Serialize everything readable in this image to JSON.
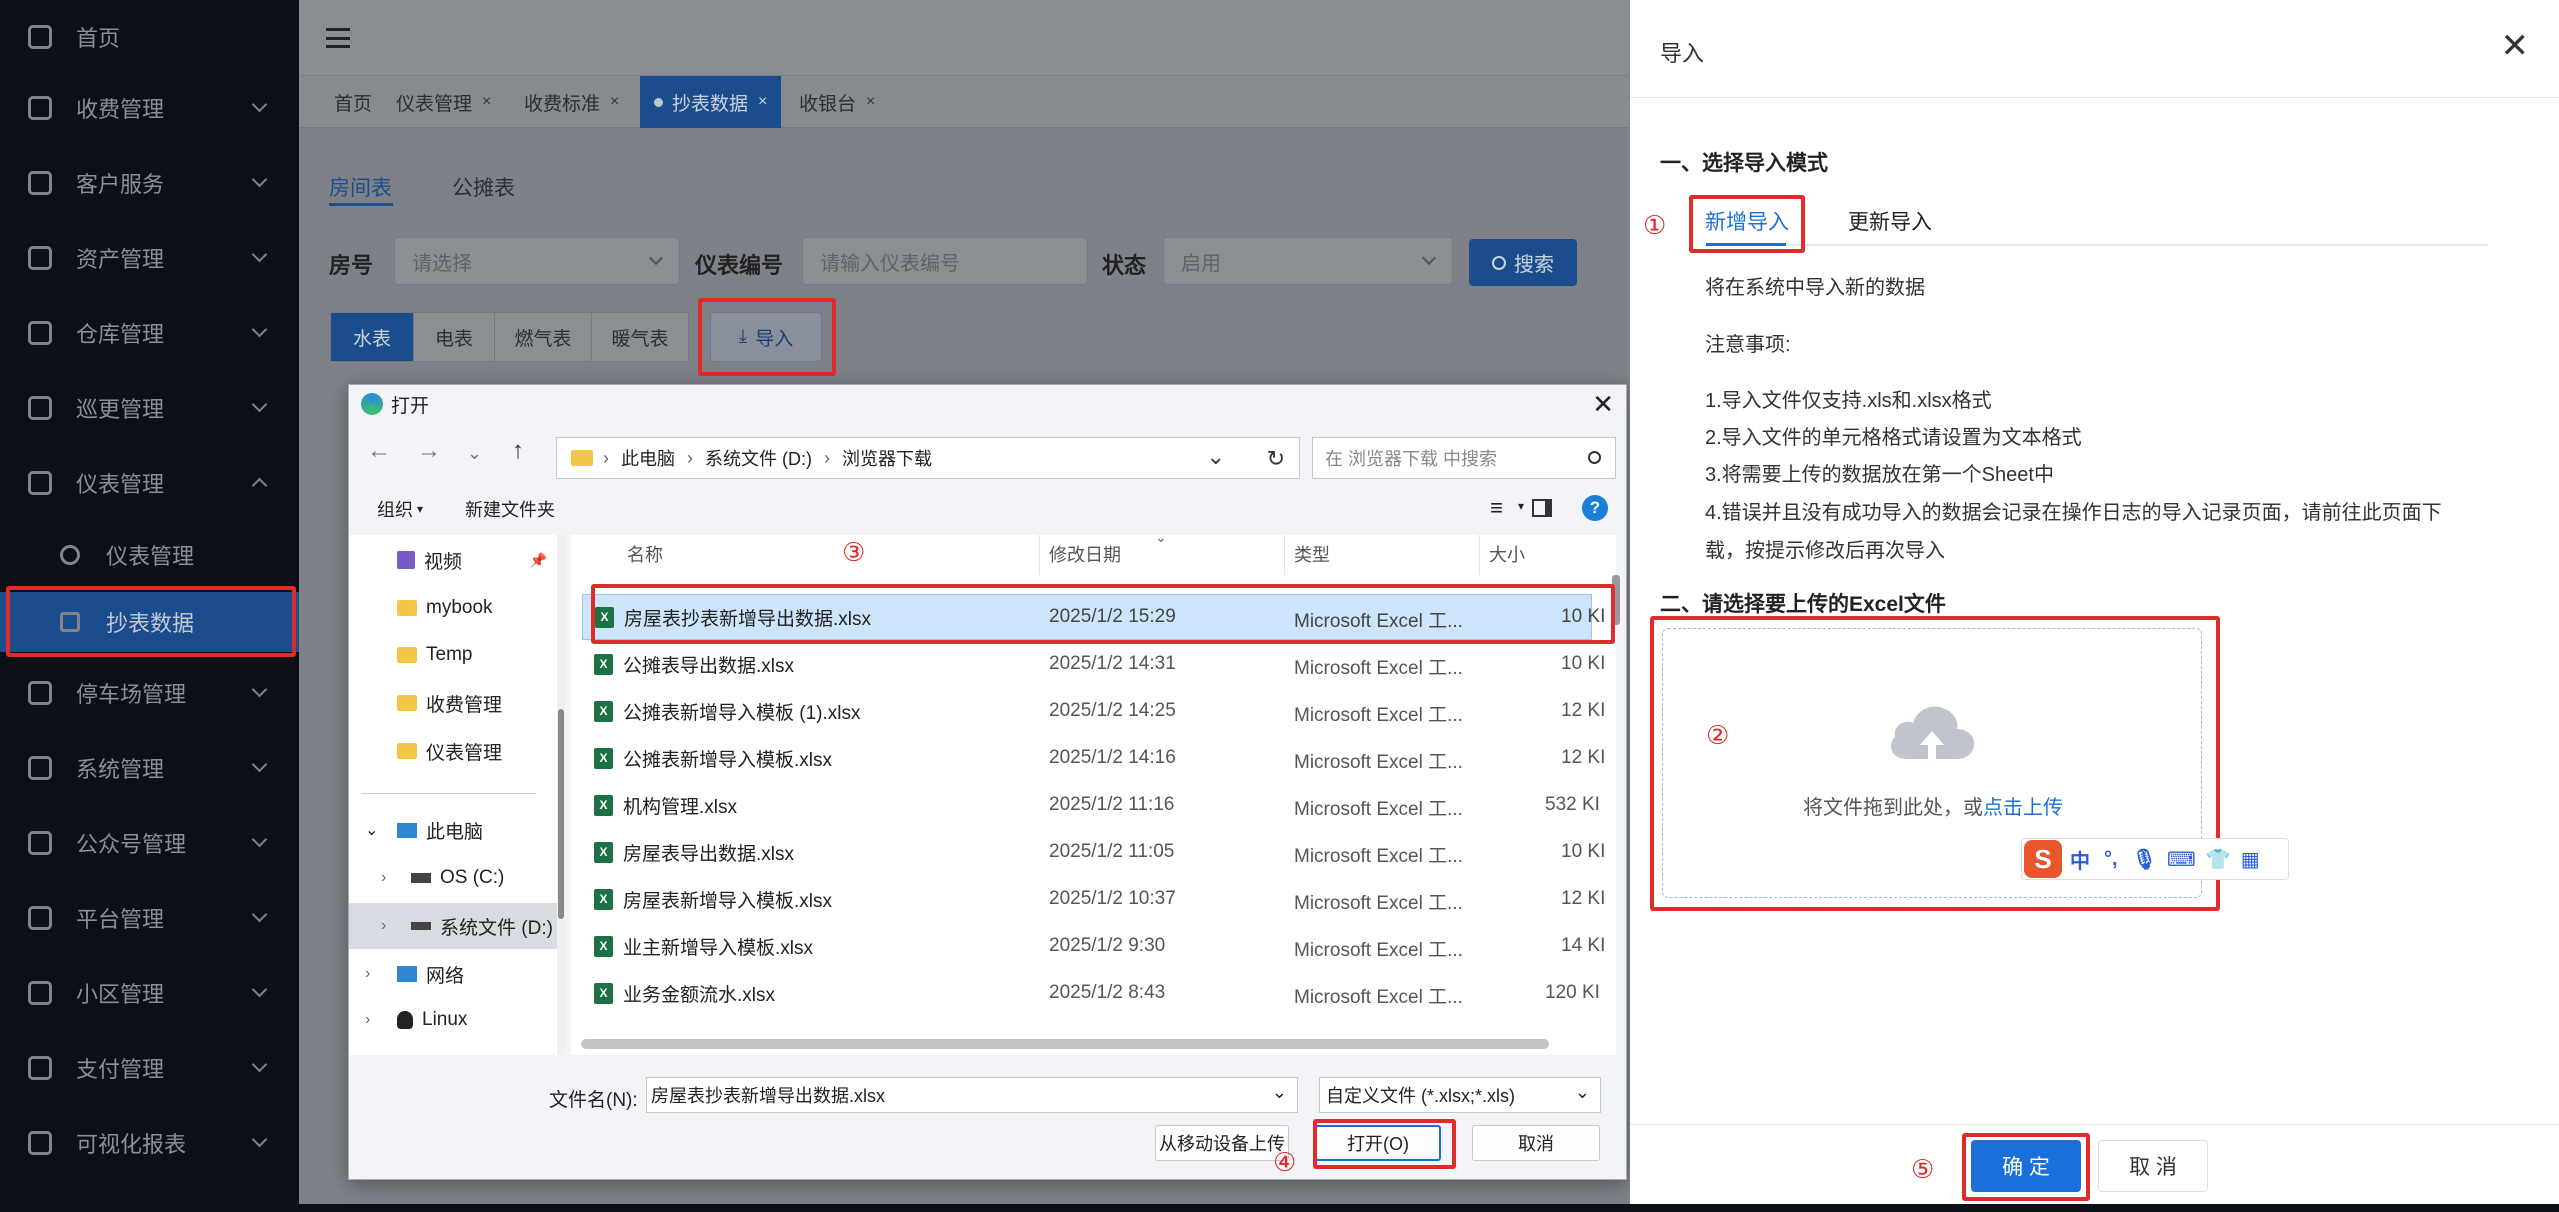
{
  "sidebar": {
    "items": [
      {
        "label": "首页",
        "icon": "dashboard-icon"
      },
      {
        "label": "收费管理",
        "icon": "billing-icon"
      },
      {
        "label": "客户服务",
        "icon": "user-service-icon"
      },
      {
        "label": "资产管理",
        "icon": "asset-icon"
      },
      {
        "label": "仓库管理",
        "icon": "warehouse-icon"
      },
      {
        "label": "巡更管理",
        "icon": "patrol-icon"
      },
      {
        "label": "仪表管理",
        "icon": "gauge-icon"
      },
      {
        "label": "仪表管理",
        "icon": "gauge-sub-icon"
      },
      {
        "label": "抄表数据",
        "icon": "meter-data-icon"
      },
      {
        "label": "停车场管理",
        "icon": "parking-icon"
      },
      {
        "label": "系统管理",
        "icon": "settings-icon"
      },
      {
        "label": "公众号管理",
        "icon": "wechat-icon"
      },
      {
        "label": "平台管理",
        "icon": "platform-icon"
      },
      {
        "label": "小区管理",
        "icon": "community-icon"
      },
      {
        "label": "支付管理",
        "icon": "yen-icon"
      },
      {
        "label": "可视化报表",
        "icon": "chart-icon"
      }
    ]
  },
  "tabs": [
    "首页",
    "仪表管理",
    "收费标准",
    "抄表数据",
    "收银台"
  ],
  "subtabs": [
    "房间表",
    "公摊表"
  ],
  "filters": {
    "room_label": "房号",
    "room_placeholder": "请选择",
    "meter_label": "仪表编号",
    "meter_placeholder": "请输入仪表编号",
    "status_label": "状态",
    "status_value": "启用",
    "search": "搜索"
  },
  "meter_tabs": [
    "水表",
    "电表",
    "燃气表",
    "暖气表"
  ],
  "import_button": "导入",
  "file_dialog": {
    "title": "打开",
    "breadcrumb": [
      "此电脑",
      "系统文件 (D:)",
      "浏览器下载"
    ],
    "search_placeholder": "在 浏览器下载 中搜索",
    "organize": "组织",
    "new_folder": "新建文件夹",
    "nav_items": [
      "视频",
      "mybook",
      "Temp",
      "收费管理",
      "仪表管理",
      "此电脑",
      "OS (C:)",
      "系统文件 (D:)",
      "网络",
      "Linux"
    ],
    "columns": [
      "名称",
      "修改日期",
      "类型",
      "大小"
    ],
    "files": [
      {
        "name": "房屋表抄表新增导出数据.xlsx",
        "date": "2025/1/2 15:29",
        "type": "Microsoft Excel 工...",
        "size": "10 KI"
      },
      {
        "name": "公摊表导出数据.xlsx",
        "date": "2025/1/2 14:31",
        "type": "Microsoft Excel 工...",
        "size": "10 KI"
      },
      {
        "name": "公摊表新增导入模板 (1).xlsx",
        "date": "2025/1/2 14:25",
        "type": "Microsoft Excel 工...",
        "size": "12 KI"
      },
      {
        "name": "公摊表新增导入模板.xlsx",
        "date": "2025/1/2 14:16",
        "type": "Microsoft Excel 工...",
        "size": "12 KI"
      },
      {
        "name": "机构管理.xlsx",
        "date": "2025/1/2 11:16",
        "type": "Microsoft Excel 工...",
        "size": "532 KI"
      },
      {
        "name": "房屋表导出数据.xlsx",
        "date": "2025/1/2 11:05",
        "type": "Microsoft Excel 工...",
        "size": "10 KI"
      },
      {
        "name": "房屋表新增导入模板.xlsx",
        "date": "2025/1/2 10:37",
        "type": "Microsoft Excel 工...",
        "size": "12 KI"
      },
      {
        "name": "业主新增导入模板.xlsx",
        "date": "2025/1/2 9:30",
        "type": "Microsoft Excel 工...",
        "size": "14 KI"
      },
      {
        "name": "业务金额流水.xlsx",
        "date": "2025/1/2 8:43",
        "type": "Microsoft Excel 工...",
        "size": "120 KI"
      }
    ],
    "filename_label": "文件名(N):",
    "filename_value": "房屋表抄表新增导出数据.xlsx",
    "filetype_value": "自定义文件 (*.xlsx;*.xls)",
    "mobile_upload": "从移动设备上传",
    "open": "打开(O)",
    "cancel": "取消"
  },
  "drawer": {
    "title": "导入",
    "section1": "一、选择导入模式",
    "mode_tabs": [
      "新增导入",
      "更新导入"
    ],
    "desc": "将在系统中导入新的数据",
    "notes_title": "注意事项:",
    "notes": [
      "1.导入文件仅支持.xls和.xlsx格式",
      "2.导入文件的单元格格式请设置为文本格式",
      "3.将需要上传的数据放在第一个Sheet中",
      "4.错误并且没有成功导入的数据会记录在操作日志的导入记录页面，请前往此页面下",
      "载，按提示修改后再次导入"
    ],
    "section2": "二、请选择要上传的Excel文件",
    "upload_text": "将文件拖到此处，或",
    "upload_link": "点击上传",
    "ime": [
      "中",
      "°,"
    ],
    "confirm": "确 定",
    "cancel": "取 消"
  },
  "annotations": [
    "①",
    "②",
    "③",
    "④",
    "⑤"
  ]
}
